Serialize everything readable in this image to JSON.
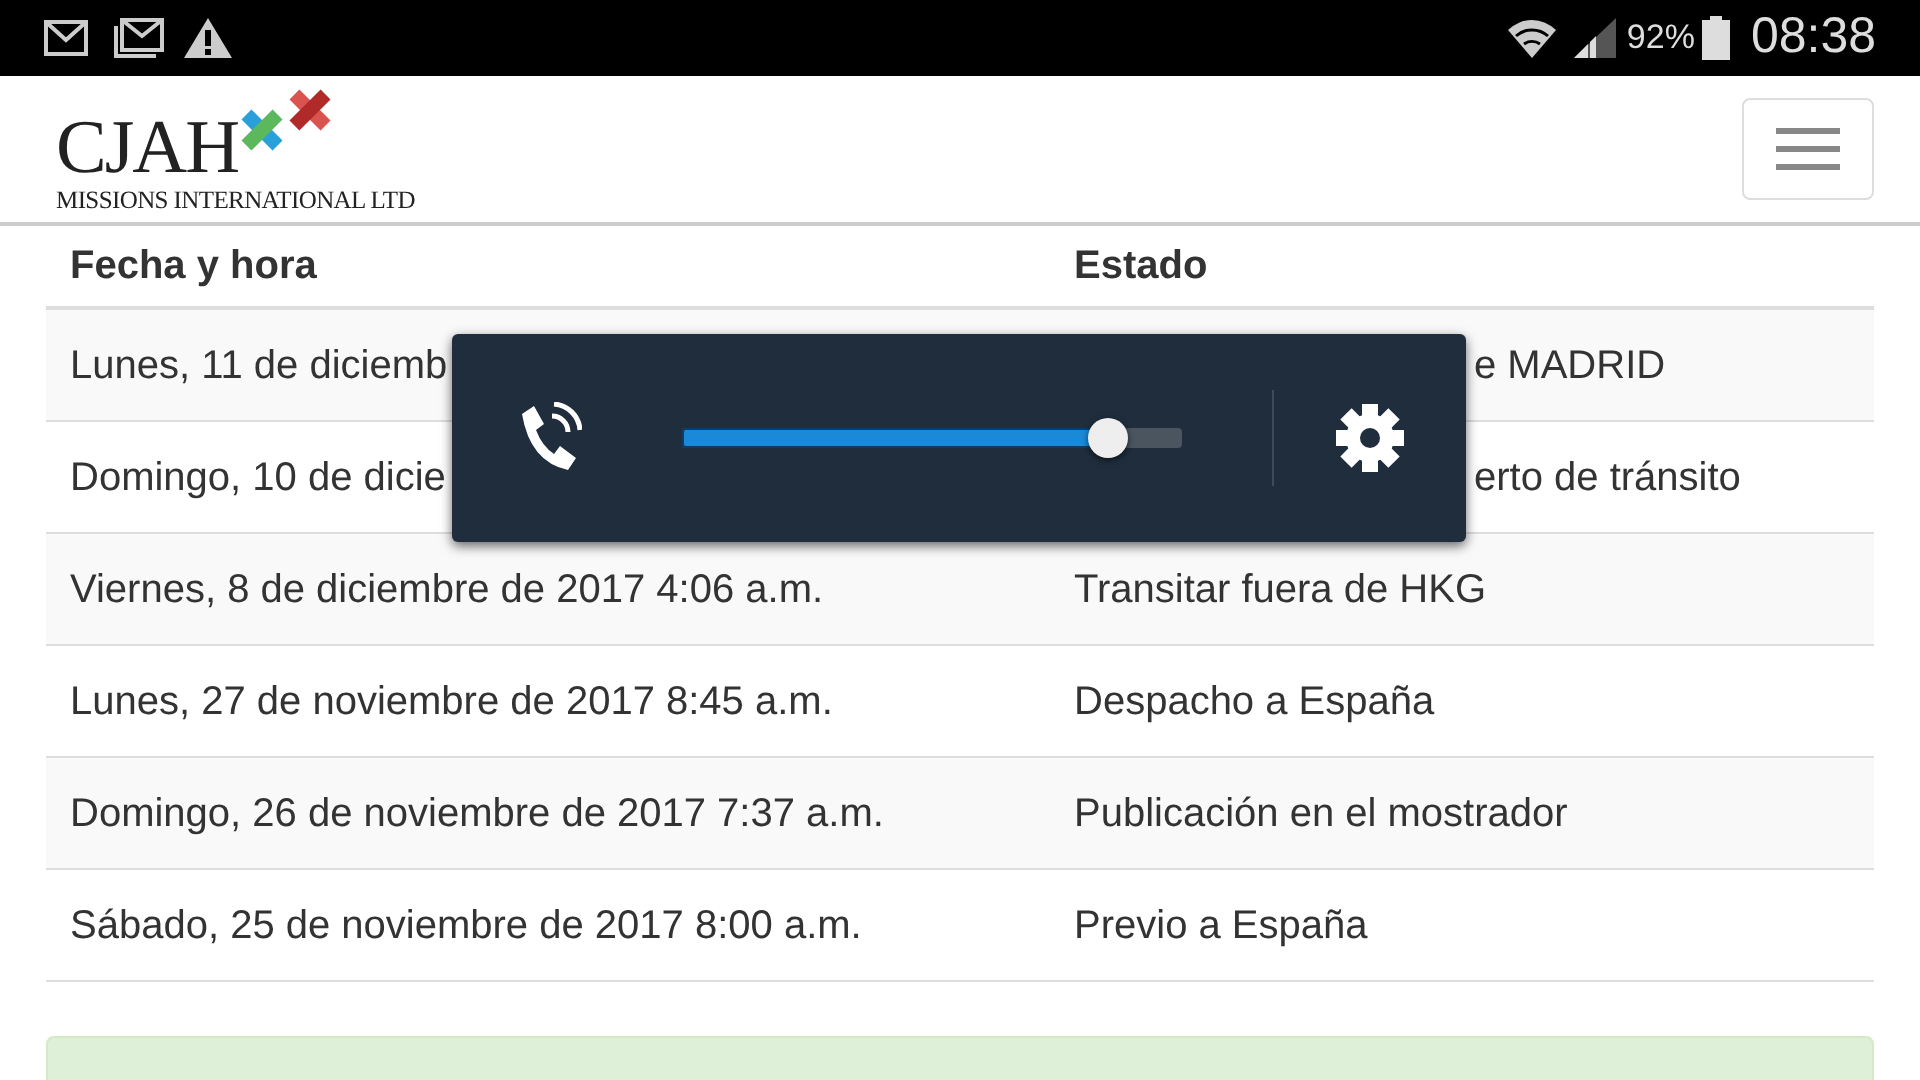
{
  "status_bar": {
    "battery_text": "92%",
    "time": "08:38"
  },
  "header": {
    "logo_text": "CJAH",
    "logo_subtitle": "MISSIONS INTERNATIONAL LTD"
  },
  "table": {
    "columns": [
      "Fecha y hora",
      "Estado"
    ],
    "rows": [
      {
        "date": "Lunes, 11 de diciemb",
        "status": "e MADRID",
        "status_hidden_start": true
      },
      {
        "date": "Domingo, 10 de dicie",
        "status": "erto de tránsito",
        "status_hidden_start": true
      },
      {
        "date": "Viernes, 8 de diciembre de 2017 4:06 a.m.",
        "status": "Transitar fuera de HKG",
        "status_hidden_start": false
      },
      {
        "date": "Lunes, 27 de noviembre de 2017 8:45 a.m.",
        "status": "Despacho a España",
        "status_hidden_start": false
      },
      {
        "date": "Domingo, 26 de noviembre de 2017 7:37 a.m.",
        "status": "Publicación en el mostrador",
        "status_hidden_start": false
      },
      {
        "date": "Sábado, 25 de noviembre de 2017 8:00 a.m.",
        "status": "Previo a España",
        "status_hidden_start": false
      }
    ]
  },
  "volume_popup": {
    "level": 0.85
  }
}
